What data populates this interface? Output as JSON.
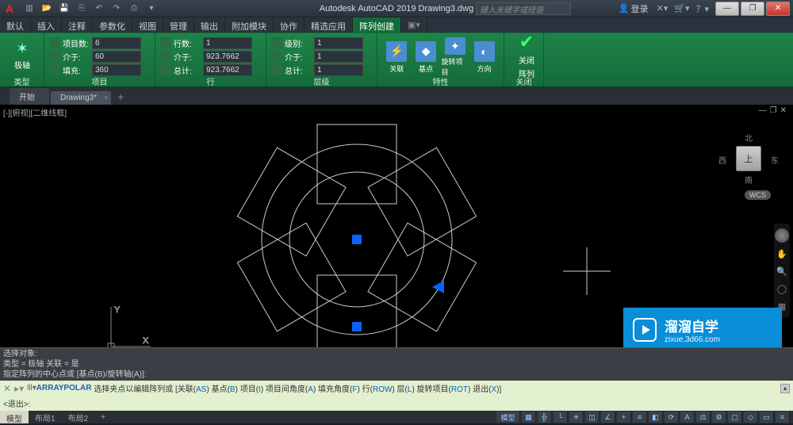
{
  "title": "Autodesk AutoCAD 2019   Drawing3.dwg",
  "search_placeholder": "键入关键字或短语",
  "login_label": "登录",
  "menu_tabs": [
    "默认",
    "插入",
    "注释",
    "参数化",
    "视图",
    "管理",
    "输出",
    "附加模块",
    "协作",
    "精选应用",
    "阵列创建"
  ],
  "ribbon": {
    "type_panel": {
      "big_label": "极轴",
      "title": "类型"
    },
    "items_panel": {
      "title": "项目",
      "count_lbl": "项目数:",
      "count_val": "6",
      "between_lbl": "介于:",
      "between_val": "60",
      "fill_lbl": "填充:",
      "fill_val": "360"
    },
    "rows_panel": {
      "title": "行",
      "count_lbl": "行数:",
      "count_val": "1",
      "between_lbl": "介于:",
      "between_val": "923.7662",
      "total_lbl": "总计:",
      "total_val": "923.7662"
    },
    "level_panel": {
      "title": "层级",
      "count_lbl": "级别:",
      "count_val": "1",
      "between_lbl": "介于:",
      "between_val": "1",
      "total_lbl": "总计:",
      "total_val": "1"
    },
    "props_panel": {
      "title": "特性",
      "assoc": "关联",
      "base": "基点",
      "rotate": "旋转项目",
      "dir": "方向"
    },
    "close_panel": {
      "title": "关闭",
      "close_lbl1": "关闭",
      "close_lbl2": "阵列"
    }
  },
  "doc_tabs": {
    "start": "开始",
    "current": "Drawing3*"
  },
  "vp_label": "[-][俯视][二维线框]",
  "axes": {
    "x": "X",
    "y": "Y"
  },
  "viewcube": {
    "top": "上",
    "n": "北",
    "s": "南",
    "e": "东",
    "w": "西",
    "wcs": "WCS"
  },
  "cmd_history": {
    "l1": "选择对象:",
    "l2": "类型 = 极轴   关联 = 是",
    "l3": "指定阵列的中心点或 [基点(B)/旋转轴(A)]:"
  },
  "cmd_active": {
    "cmd": "ARRAYPOLAR",
    "prompt": "选择夹点以编辑阵列或",
    "opts": "[关联(AS) 基点(B) 项目(I) 项目间角度(A) 填充角度(F) 行(ROW) 层(L) 旋转项目(ROT) 退出(X)]",
    "exit": "<退出>:"
  },
  "status": {
    "model": "模型",
    "layout1": "布局1",
    "layout2": "布局2",
    "model_btn": "模型"
  },
  "watermark": {
    "title": "溜溜自学",
    "url": "zixue.3d66.com"
  }
}
